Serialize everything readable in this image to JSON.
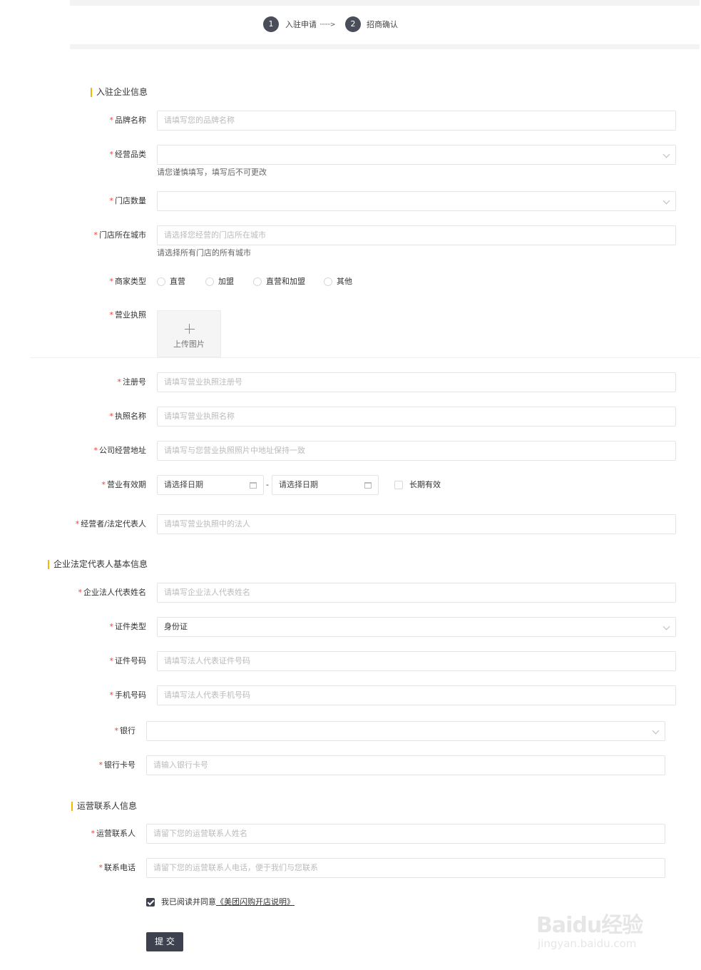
{
  "steps": [
    {
      "number": "1",
      "label": "入驻申请"
    },
    {
      "number": "2",
      "label": "招商确认"
    }
  ],
  "step_arrow": "········>",
  "sections": {
    "company": "入驻企业信息",
    "legal": "企业法定代表人基本信息",
    "contact": "运营联系人信息"
  },
  "fields": {
    "brand_name": {
      "label": "品牌名称",
      "placeholder": "请填写您的品牌名称"
    },
    "category": {
      "label": "经营品类",
      "hint": "请您谨慎填写，填写后不可更改"
    },
    "store_count": {
      "label": "门店数量"
    },
    "store_city": {
      "label": "门店所在城市",
      "placeholder": "请选择您经营的门店所在城市",
      "hint": "请选择所有门店的所有城市"
    },
    "merchant_type": {
      "label": "商家类型",
      "options": [
        "直营",
        "加盟",
        "直营和加盟",
        "其他"
      ]
    },
    "license": {
      "label": "营业执照",
      "upload_label": "上传图片"
    },
    "reg_no": {
      "label": "注册号",
      "placeholder": "请填写营业执照注册号"
    },
    "license_name": {
      "label": "执照名称",
      "placeholder": "请填写营业执照名称"
    },
    "address": {
      "label": "公司经营地址",
      "placeholder": "请填写与您营业执照照片中地址保持一致"
    },
    "validity": {
      "label": "营业有效期",
      "start_placeholder": "请选择日期",
      "separator": "-",
      "end_placeholder": "请选择日期",
      "long_term": "长期有效"
    },
    "operator": {
      "label": "经营者/法定代表人",
      "placeholder": "请填写营业执照中的法人"
    },
    "legal_name": {
      "label": "企业法人代表姓名",
      "placeholder": "请填写企业法人代表姓名"
    },
    "id_type": {
      "label": "证件类型",
      "value": "身份证"
    },
    "id_number": {
      "label": "证件号码",
      "placeholder": "请填写法人代表证件号码"
    },
    "phone": {
      "label": "手机号码",
      "placeholder": "请填写法人代表手机号码"
    },
    "bank": {
      "label": "银行"
    },
    "bank_card": {
      "label": "银行卡号",
      "placeholder": "请输入银行卡号"
    },
    "contact_name": {
      "label": "运营联系人",
      "placeholder": "请留下您的运营联系人姓名"
    },
    "contact_phone": {
      "label": "联系电话",
      "placeholder": "请留下您的运营联系人电话，便于我们与您联系"
    }
  },
  "agreement": {
    "prefix": "我已阅读并同意",
    "link": "《美团闪购开店说明》",
    "checked": true
  },
  "submit_label": "提 交",
  "watermark": {
    "brand": "Baidu经验",
    "url": "jingyan.baidu.com"
  },
  "colors": {
    "accent": "#f5b800",
    "primary": "#3e4150",
    "required": "#e64340"
  }
}
